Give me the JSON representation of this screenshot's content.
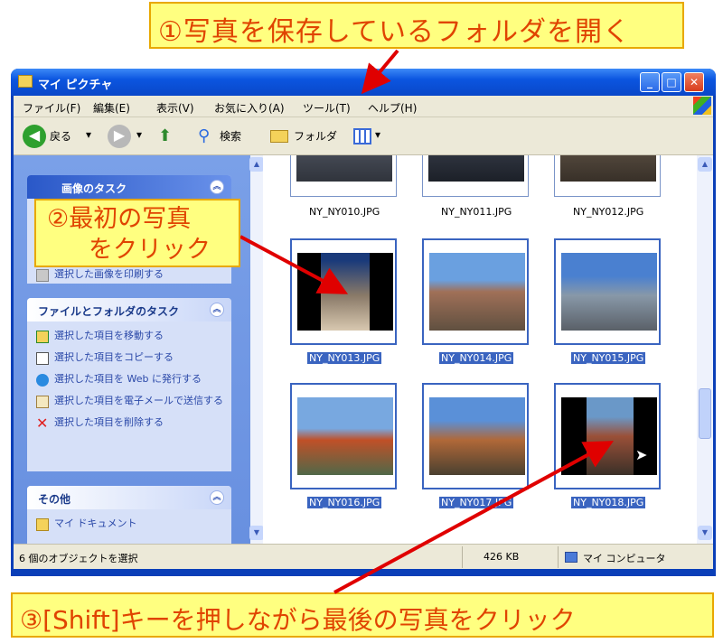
{
  "callouts": {
    "step1": "①写真を保存しているフォルダを開く",
    "step2_line1": "②最初の写真",
    "step2_line2": "をクリック",
    "step3": "③[Shift]キーを押しながら最後の写真をクリック"
  },
  "window": {
    "title": "マイ ピクチャ",
    "buttons": {
      "minimize": "_",
      "maximize": "□",
      "close": "✕"
    }
  },
  "menu": [
    "ファイル(F)",
    "編集(E)",
    "表示(V)",
    "お気に入り(A)",
    "ツール(T)",
    "ヘルプ(H)"
  ],
  "toolbar": {
    "back": "戻る",
    "search": "検索",
    "folders": "フォルダ"
  },
  "sidebar": {
    "picture_tasks": {
      "title": "画像のタスク",
      "items": [
        "選択した画像を印刷する"
      ]
    },
    "file_tasks": {
      "title": "ファイルとフォルダのタスク",
      "items": [
        "選択した項目を移動する",
        "選択した項目をコピーする",
        "選択した項目を Web に発行する",
        "選択した項目を電子メールで送信する",
        "選択した項目を削除する"
      ]
    },
    "other": {
      "title": "その他",
      "items": [
        "マイ ドキュメント"
      ]
    }
  },
  "files": {
    "row0": [
      "NY_NY010.JPG",
      "NY_NY011.JPG",
      "NY_NY012.JPG"
    ],
    "row1": [
      "NY_NY013.JPG",
      "NY_NY014.JPG",
      "NY_NY015.JPG"
    ],
    "row2": [
      "NY_NY016.JPG",
      "NY_NY017.JPG",
      "NY_NY018.JPG"
    ]
  },
  "status": {
    "selection": "6 個のオブジェクトを選択",
    "size": "426 KB",
    "location": "マイ コンピュータ"
  },
  "colors": {
    "callout_bg": "#ffff80",
    "callout_text": "#e04400",
    "arrow": "#e00000",
    "selection": "#3a64c0"
  },
  "icons": [
    "back-icon",
    "forward-icon",
    "up-icon",
    "search-icon",
    "folder-icon",
    "views-icon",
    "printer-icon",
    "move-icon",
    "copy-icon",
    "web-icon",
    "mail-icon",
    "delete-icon"
  ]
}
